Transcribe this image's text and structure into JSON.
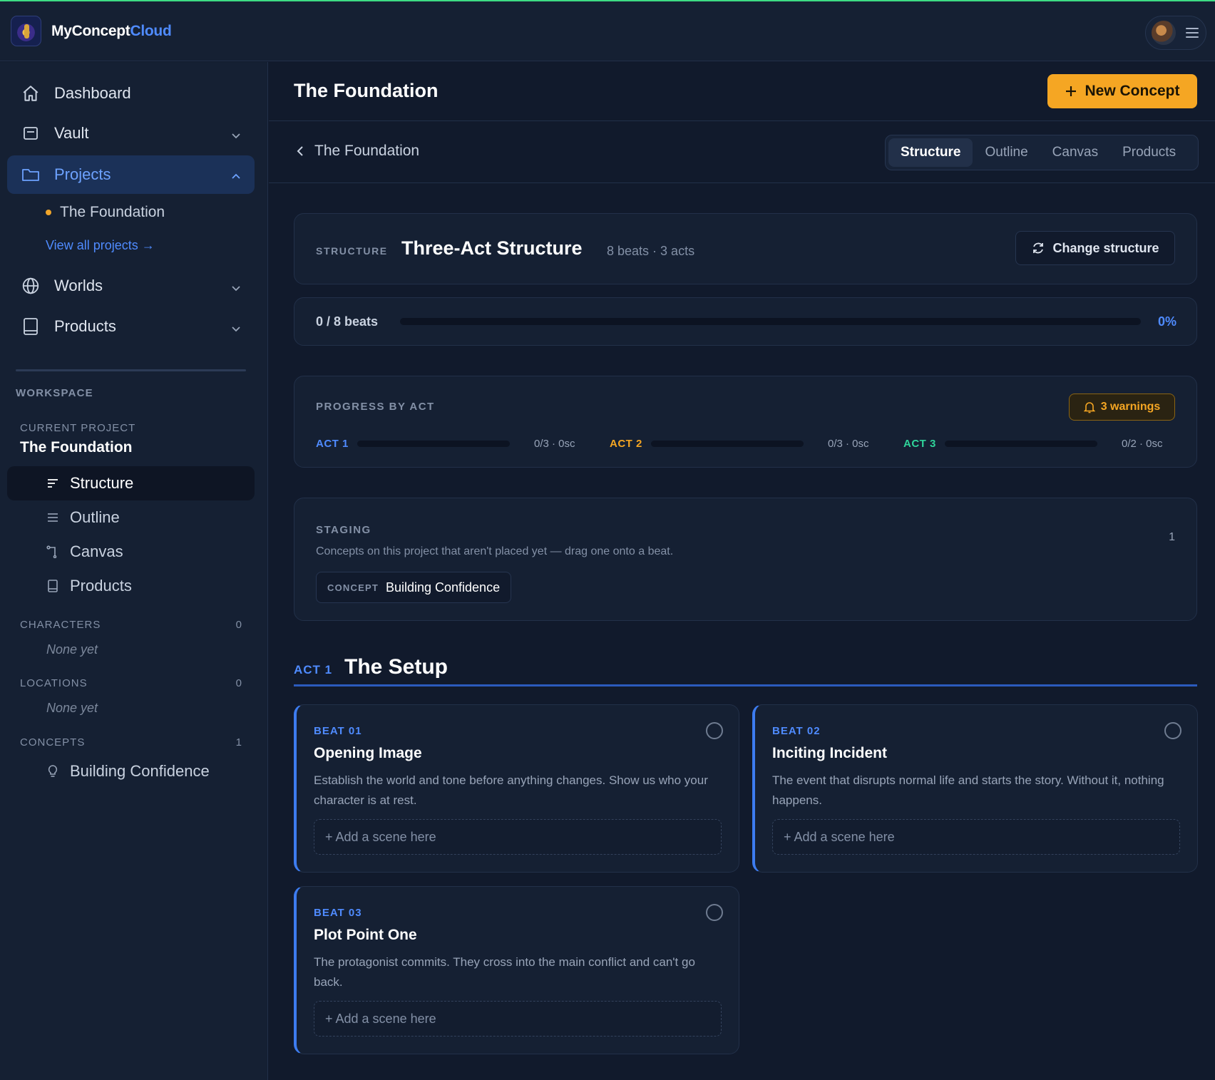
{
  "app": {
    "brand_primary": "MyConcept",
    "brand_accent": "Cloud",
    "accent_color": "#4f8bff",
    "cta_color": "#f5a623"
  },
  "sidebar": {
    "nav": [
      {
        "label": "Dashboard",
        "icon": "home-icon"
      },
      {
        "label": "Vault",
        "icon": "vault-icon"
      },
      {
        "label": "Projects",
        "icon": "folder-icon"
      },
      {
        "label": "Worlds",
        "icon": "globe-icon"
      },
      {
        "label": "Products",
        "icon": "book-icon"
      }
    ],
    "project_link": "The Foundation",
    "view_all": "View all projects →",
    "workspace_label": "WORKSPACE",
    "current_project_label": "CURRENT PROJECT",
    "current_project_name": "The Foundation",
    "workspace_items": [
      {
        "label": "Structure",
        "icon": "structure-icon"
      },
      {
        "label": "Outline",
        "icon": "list-icon"
      },
      {
        "label": "Canvas",
        "icon": "canvas-icon"
      },
      {
        "label": "Products",
        "icon": "book-icon"
      }
    ],
    "characters": {
      "label": "CHARACTERS",
      "count": "0",
      "empty": "None yet"
    },
    "locations": {
      "label": "LOCATIONS",
      "count": "0",
      "empty": "None yet"
    },
    "concepts": {
      "label": "CONCEPTS",
      "count": "1",
      "items": [
        "Building Confidence"
      ]
    }
  },
  "header": {
    "title": "The Foundation",
    "new_button": "New Concept",
    "breadcrumb": "The Foundation",
    "tabs": [
      "Structure",
      "Outline",
      "Canvas",
      "Products"
    ],
    "active_tab": "Structure"
  },
  "structure": {
    "label": "STRUCTURE",
    "name": "Three-Act Structure",
    "meta": "8 beats · 3 acts",
    "change_button": "Change structure"
  },
  "progress": {
    "beats": "0 / 8 beats",
    "percent_text": "0%",
    "fraction": 0
  },
  "progress_by_act": {
    "label": "PROGRESS BY ACT",
    "warnings": "3 warnings",
    "acts": [
      {
        "name": "ACT 1",
        "count": "0/3 · 0sc",
        "color": "#4f8bff"
      },
      {
        "name": "ACT 2",
        "count": "0/3 · 0sc",
        "color": "#f5a623"
      },
      {
        "name": "ACT 3",
        "count": "0/2 · 0sc",
        "color": "#2fd39a"
      }
    ]
  },
  "staging": {
    "label": "STAGING",
    "description": "Concepts on this project that aren't placed yet — drag one onto a beat.",
    "count": "1",
    "chip_kind": "CONCEPT",
    "chip_name": "Building Confidence"
  },
  "act1": {
    "tag": "ACT 1",
    "title": "The Setup",
    "beats": [
      {
        "num": "BEAT 01",
        "title": "Opening Image",
        "desc": "Establish the world and tone before anything changes. Show us who your character is at rest.",
        "add": "+ Add a scene here"
      },
      {
        "num": "BEAT 02",
        "title": "Inciting Incident",
        "desc": "The event that disrupts normal life and starts the story. Without it, nothing happens.",
        "add": "+ Add a scene here"
      },
      {
        "num": "BEAT 03",
        "title": "Plot Point One",
        "desc": "The protagonist commits. They cross into the main conflict and can't go back.",
        "add": "+ Add a scene here"
      }
    ]
  }
}
